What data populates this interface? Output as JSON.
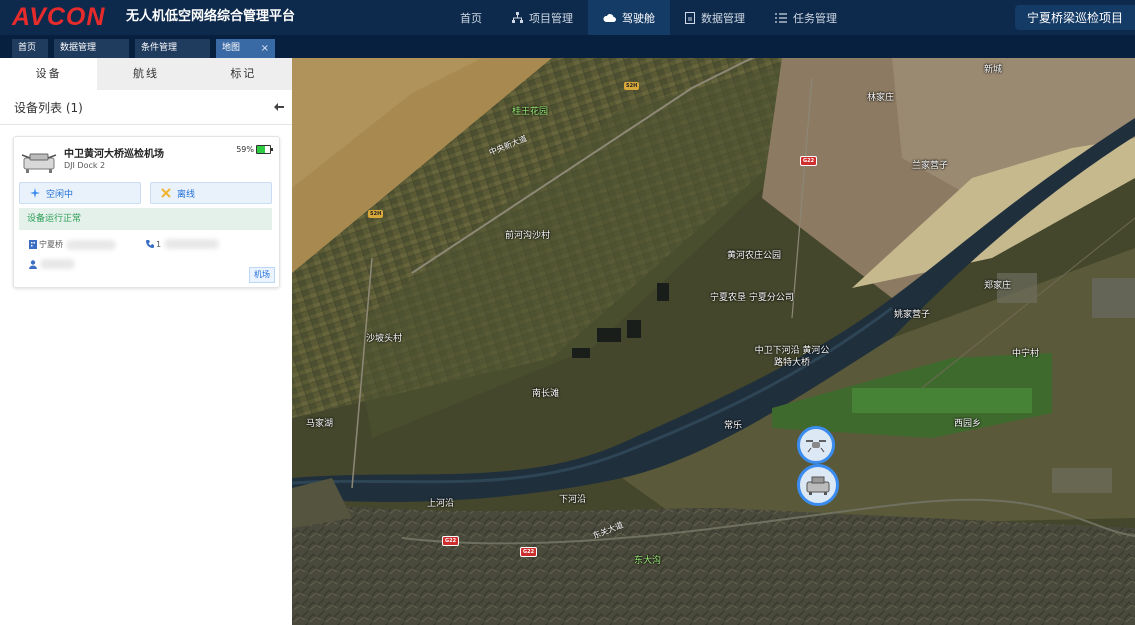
{
  "header": {
    "logo_text": "AVCON",
    "app_title": "无人机低空网络综合管理平台",
    "nav": [
      {
        "label": "首页",
        "icon": "none"
      },
      {
        "label": "项目管理",
        "icon": "hierarchy-icon"
      },
      {
        "label": "驾驶舱",
        "icon": "cloud-icon",
        "active": true
      },
      {
        "label": "数据管理",
        "icon": "document-icon"
      },
      {
        "label": "任务管理",
        "icon": "list-icon"
      }
    ],
    "project_name": "宁夏桥梁巡检项目"
  },
  "tabs": [
    {
      "label": "首页"
    },
    {
      "label": "数据管理"
    },
    {
      "label": "条件管理"
    },
    {
      "label": "地图",
      "active": true,
      "close": "×"
    }
  ],
  "sidebar": {
    "subtabs": [
      "设备",
      "航线",
      "标记"
    ],
    "list_title": "设备列表 (1)",
    "collapse_icon": "arrow-left-icon",
    "device": {
      "name": "中卫黄河大桥巡检机场",
      "model": "DJI Dock 2",
      "battery": "59%",
      "battery_level": 0.59,
      "status_left": "空闲中",
      "status_right": "离线",
      "health": "设备运行正常",
      "org_prefix": "宁夏桥",
      "phone_prefix": "1",
      "tag": "机场"
    }
  },
  "map": {
    "labels": {
      "l1": "桂王花园",
      "l2": "中央新大道",
      "l3": "林家庄",
      "l4": "兰家营子",
      "l5": "新城",
      "l6": "前河沟沙村",
      "l7": "黄河农庄公园",
      "l8": "宁夏农垦 宁夏分公司",
      "l9": "姚家营子",
      "l10": "沙坡头村",
      "l11": "中卫下河沿 黄河公路特大桥",
      "l12": "马家湖",
      "l13": "南长滩",
      "l14": "常乐",
      "l15": "西园乡",
      "l16": "上河沿",
      "l17": "下河沿",
      "l18": "东关大道",
      "l19": "东大沟",
      "l20": "郑家庄",
      "l21": "中宁村"
    },
    "shields": [
      "S2H",
      "G22",
      "S2H",
      "G22",
      "G22"
    ]
  },
  "colors": {
    "header_bg": "#0d2a4c",
    "accent": "#1f6fd6",
    "logo": "#e52b2b",
    "ok": "#2a9c55"
  }
}
